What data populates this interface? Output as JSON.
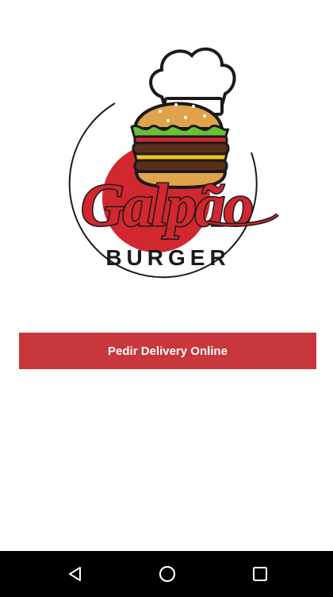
{
  "logo": {
    "wordmark": "Galpão",
    "subtitle": "BURGER"
  },
  "main": {
    "cta_label": "Pedir Delivery Online"
  },
  "colors": {
    "brand_red": "#c8373b",
    "logo_red": "#d1272f",
    "navbar": "#000000"
  },
  "navbar": {
    "icons": [
      "back-icon",
      "home-icon",
      "recents-icon"
    ]
  }
}
